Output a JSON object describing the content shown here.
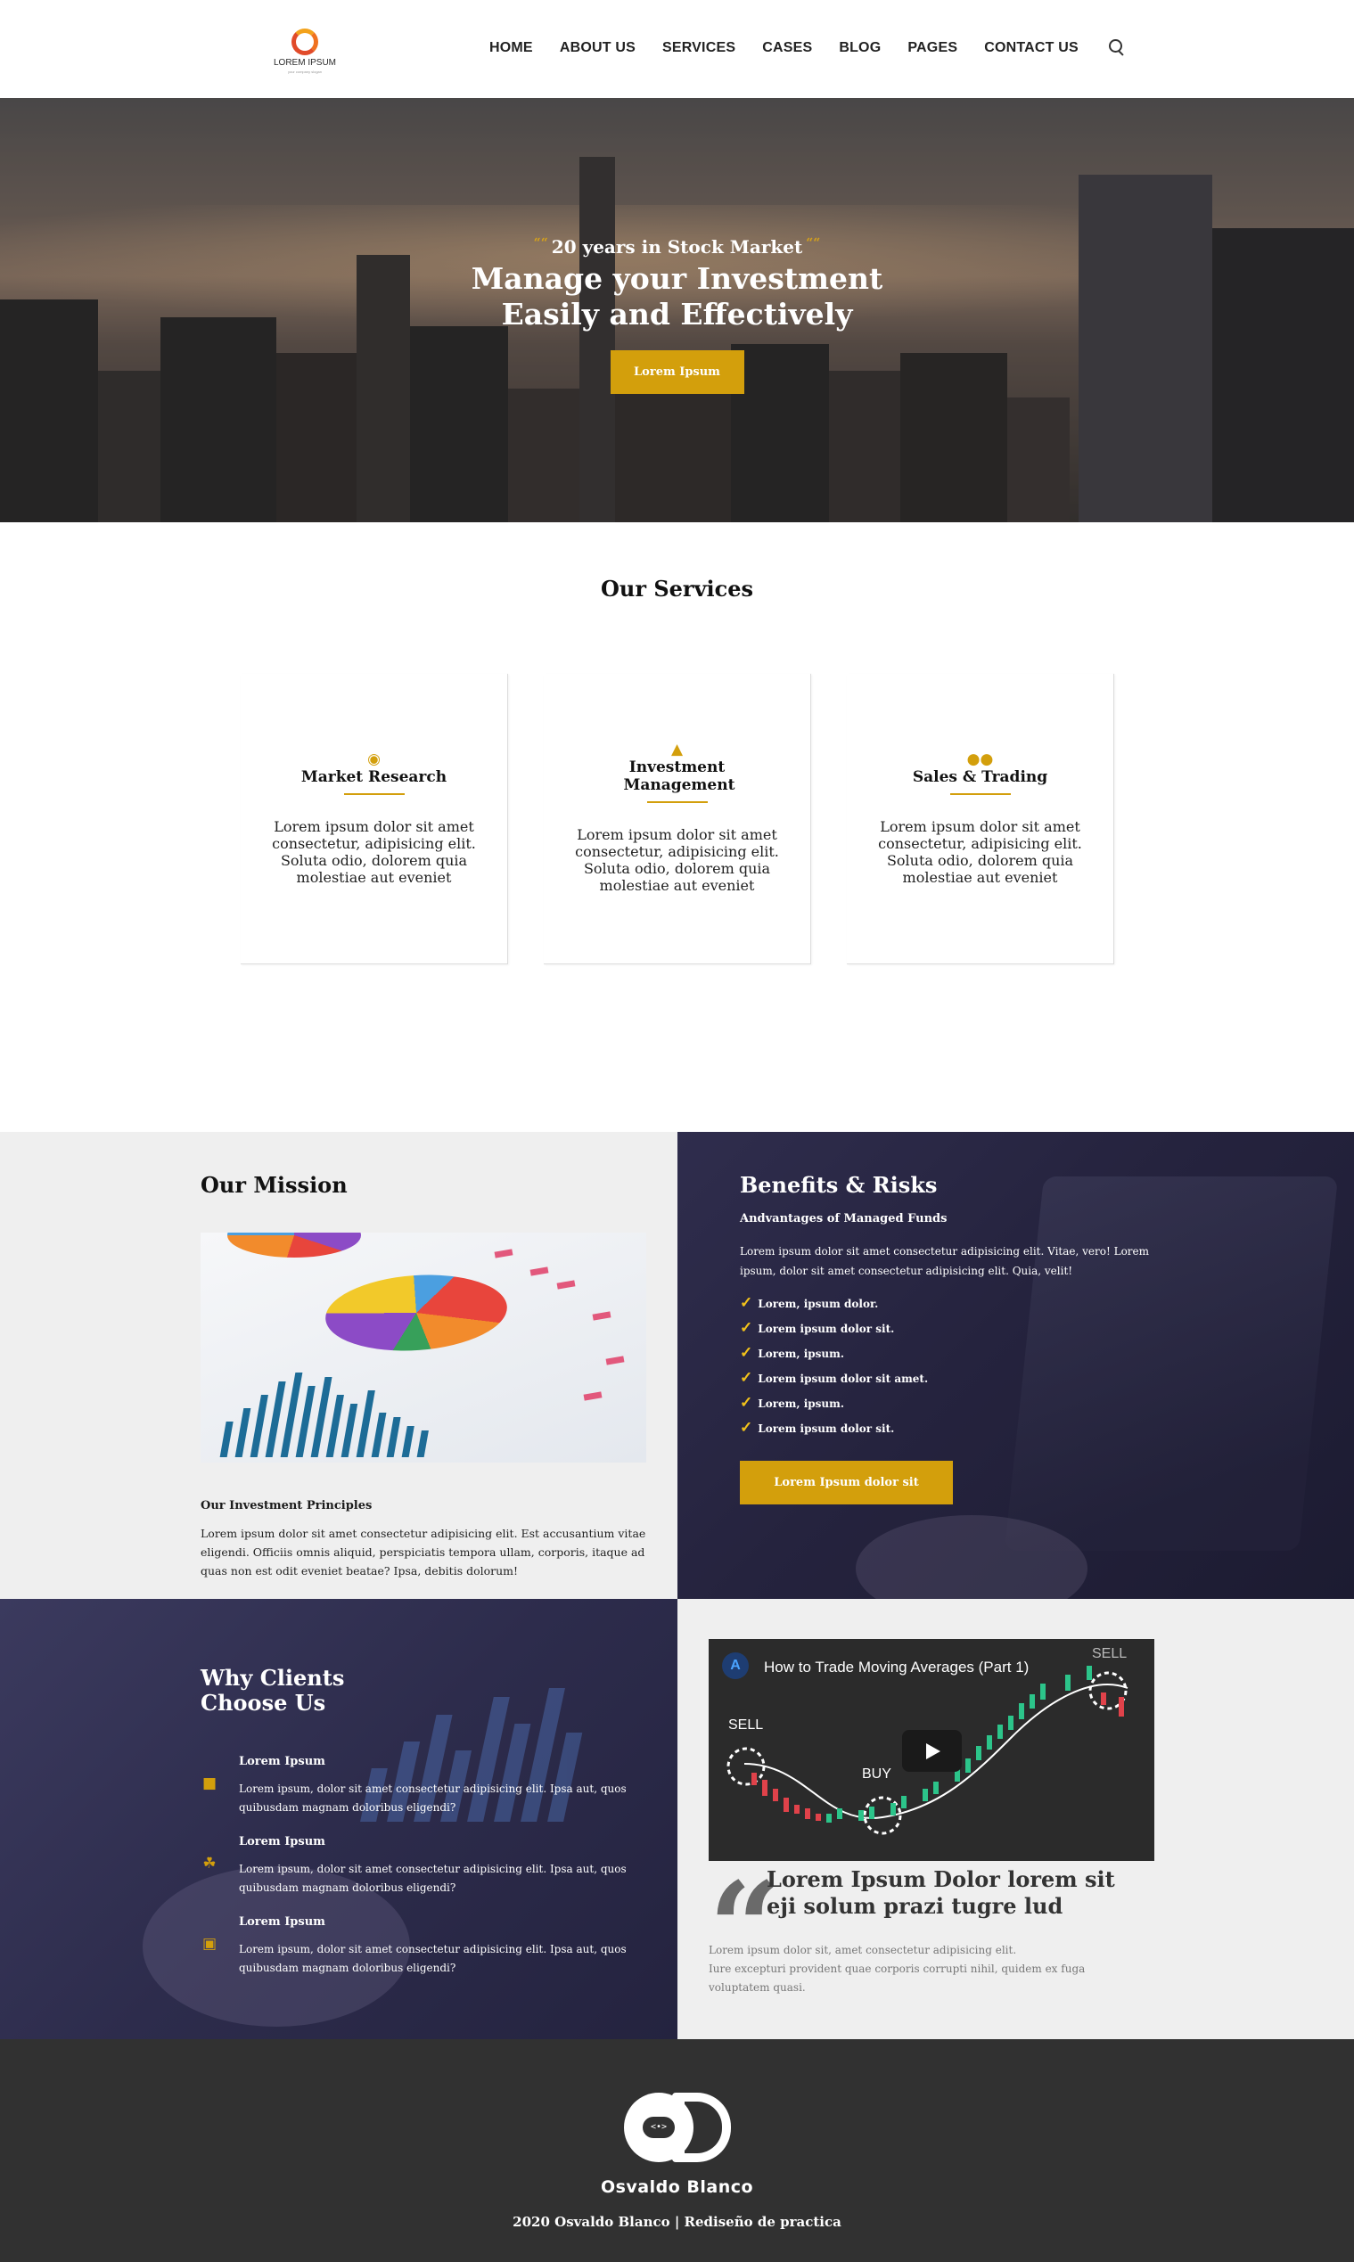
{
  "header": {
    "logo_text": "LOREM IPSUM",
    "logo_sub": "your company slogan",
    "nav": [
      "HOME",
      "ABOUT US",
      "SERVICES",
      "CASES",
      "BLOG",
      "PAGES",
      "CONTACT US"
    ]
  },
  "hero": {
    "subtitle": "20 years in Stock Market",
    "title_line1": "Manage your Investment",
    "title_line2": "Easily and Effectively",
    "button": "Lorem Ipsum"
  },
  "services": {
    "title": "Our Services",
    "cards": [
      {
        "icon": "eye-icon",
        "title": "Market Research",
        "text": "Lorem ipsum dolor sit amet consectetur, adipisicing elit. Soluta odio, dolorem quia molestiae aut eveniet"
      },
      {
        "icon": "thumbs-up-icon",
        "title": "Investment Management",
        "text": "Lorem ipsum dolor sit amet consectetur, adipisicing elit. Soluta odio, dolorem quia molestiae aut eveniet"
      },
      {
        "icon": "people-icon",
        "title": "Sales & Trading",
        "text": "Lorem ipsum dolor sit amet consectetur, adipisicing elit. Soluta odio, dolorem quia molestiae aut eveniet"
      }
    ]
  },
  "mission": {
    "title": "Our Mission",
    "subtitle": "Our Investment Principles",
    "text": "Lorem ipsum dolor sit amet consectetur adipisicing elit. Est accusantium vitae eligendi. Officiis omnis aliquid, perspiciatis tempora ullam, corporis, itaque ad quas non est odit eveniet beatae? Ipsa, debitis dolorum!"
  },
  "benefits": {
    "title": "Benefits & Risks",
    "subtitle": "Andvantages of Managed Funds",
    "text": "Lorem ipsum dolor sit amet consectetur adipisicing elit. Vitae, vero! Lorem ipsum, dolor sit amet consectetur adipisicing elit. Quia, velit!",
    "items": [
      "Lorem, ipsum dolor.",
      "Lorem ipsum dolor sit.",
      "Lorem, ipsum.",
      "Lorem ipsum dolor sit amet.",
      "Lorem, ipsum.",
      "Lorem ipsum dolor sit."
    ],
    "button": "Lorem Ipsum dolor sit"
  },
  "why": {
    "title_line1": "Why Clients",
    "title_line2": "Choose Us",
    "features": [
      {
        "icon": "briefcase-icon",
        "title": "Lorem Ipsum",
        "text": "Lorem ipsum, dolor sit amet consectetur adipisicing elit. Ipsa aut, quos quibusdam magnam doloribus eligendi?"
      },
      {
        "icon": "plant-icon",
        "title": "Lorem Ipsum",
        "text": "Lorem ipsum, dolor sit amet consectetur adipisicing elit. Ipsa aut, quos quibusdam magnam doloribus eligendi?"
      },
      {
        "icon": "wallet-icon",
        "title": "Lorem Ipsum",
        "text": "Lorem ipsum, dolor sit amet consectetur adipisicing elit. Ipsa aut, quos quibusdam magnam doloribus eligendi?"
      }
    ]
  },
  "video": {
    "title": "How to Trade Moving Averages (Part 1)",
    "labels": [
      "SELL",
      "BUY",
      "SELL"
    ]
  },
  "quote": {
    "title": "Lorem Ipsum Dolor lorem sit eji solum prazi tugre lud",
    "text_line1": "Lorem ipsum dolor sit, amet consectetur adipisicing elit.",
    "text_line2": "Iure excepturi provident quae corporis corrupti nihil, quidem ex fuga voluptatem quasi."
  },
  "footer": {
    "name": "Osvaldo Blanco",
    "copyright": "2020 Osvaldo Blanco | Rediseño de practica"
  },
  "colors": {
    "accent": "#d39f0c",
    "dark_panel": "#25233e",
    "footer": "#313131"
  }
}
